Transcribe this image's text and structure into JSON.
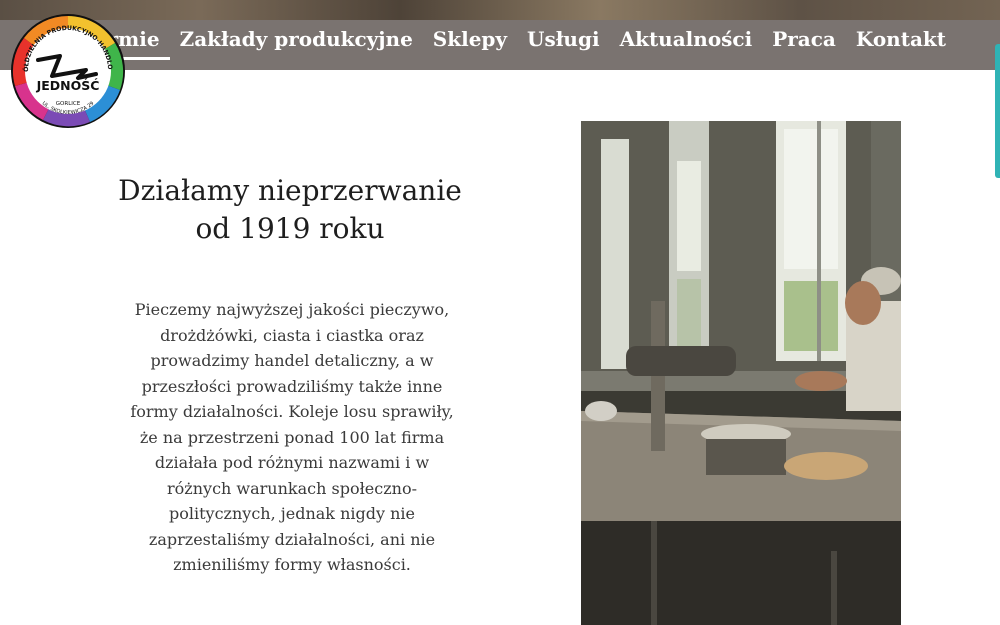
{
  "logo": {
    "top_arc_text": "SPÓŁDZIELNIA PRODUKCYJNO-HANDLOWA",
    "name": "JEDNOŚĆ",
    "city": "GORLICE",
    "address": "UL. SKOLKIEWICZA 29"
  },
  "nav": {
    "items": [
      {
        "label": "O firmie",
        "active": true
      },
      {
        "label": "Zakłady produkcyjne",
        "active": false
      },
      {
        "label": "Sklepy",
        "active": false
      },
      {
        "label": "Usługi",
        "active": false
      },
      {
        "label": "Aktualności",
        "active": false
      },
      {
        "label": "Praca",
        "active": false
      },
      {
        "label": "Kontakt",
        "active": false
      }
    ]
  },
  "main": {
    "heading_line1": "Działamy nieprzerwanie",
    "heading_line2": "od 1919 roku",
    "body": "Pieczemy najwyższej jakości pieczywo, drożdżówki, ciasta i ciastka oraz prowadzimy handel detaliczny, a w przeszłości prowadziliśmy także inne formy działalności. Koleje losu sprawiły, że na przestrzeni ponad 100 lat firma działała pod różnymi nazwami i w różnych warunkach społeczno-politycznych, jednak nigdy nie zaprzestaliśmy działalności, ani nie zmieniliśmy formy własności."
  },
  "colors": {
    "navbar": "#7a7370",
    "accent_scrollbar": "#2fb3b5",
    "heading_text": "#1e1e1e",
    "body_text": "#3a3a3a"
  }
}
